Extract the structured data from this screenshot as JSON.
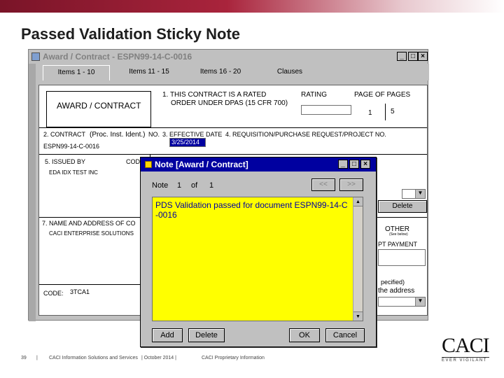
{
  "slide": {
    "title": "Passed Validation Sticky Note"
  },
  "window": {
    "title": "Award / Contract - ESPN99-14-C-0016",
    "buttons": {
      "minimize": "_",
      "restore": "□",
      "close": "×"
    }
  },
  "tabs": [
    {
      "label": "Items 1 - 10"
    },
    {
      "label": "Items 11 - 15"
    },
    {
      "label": "Items 16 - 20"
    },
    {
      "label": "Clauses"
    }
  ],
  "form": {
    "award_title": "AWARD / CONTRACT",
    "rated_label": "1. THIS CONTRACT IS A RATED",
    "dpas_label": "ORDER UNDER DPAS (15 CFR 700)",
    "rating_label": "RATING",
    "page_label": "PAGE OF PAGES",
    "page_current": "1",
    "page_total": "5",
    "contract_label": "2. CONTRACT",
    "proc_label": "(Proc. Inst. Ident.)",
    "no_label": "NO.",
    "contract_no": "ESPN99-14-C-0016",
    "effective_label": "3. EFFECTIVE DATE",
    "effective_date": "3/25/2014",
    "requisition_label": "4. REQUISITION/PURCHASE  REQUEST/PROJECT NO.",
    "issued_by_label": "5. ISSUED BY",
    "code_label": "COD",
    "issued_by_value": "EDA IDX TEST INC",
    "delete_label": "Delete",
    "name_label": "7. NAME AND ADDRESS OF CO",
    "name_value": "CACI ENTERPRISE SOLUTIONS",
    "other_label": "OTHER",
    "see_below_label": "(See below)",
    "prompt_payment_label": "PT PAYMENT",
    "specified_label": "pecified)",
    "address_label": "the address",
    "code_bottom_label": "CODE:",
    "code_bottom_value": "3TCA1"
  },
  "note": {
    "title": "Note [Award / Contract]",
    "note_label": "Note",
    "current": "1",
    "of_label": "of",
    "total": "1",
    "prev_label": "<<",
    "next_label": ">>",
    "text_line1": "PDS Validation passed for document ESPN99-14-C",
    "text_line2": "-0016",
    "buttons": {
      "add": "Add",
      "delete": "Delete",
      "ok": "OK",
      "cancel": "Cancel"
    },
    "text_color": "#0000a0",
    "background_color": "#ffff00"
  },
  "footer": {
    "page_number": "39",
    "sep1": "|",
    "company": "CACI Information Solutions and Services",
    "date": "| October 2014 |",
    "proprietary": "CACI Proprietary Information"
  },
  "logo": {
    "word": "CACI",
    "tagline": "EVER VIGILANT"
  },
  "colors": {
    "brand_red": "#a9243c",
    "window_gray": "#c0c0c0",
    "title_blue": "#0000a0"
  },
  "icons": [
    "window-system-icon",
    "note-icon",
    "dropdown-arrow-icon",
    "scroll-up-icon",
    "scroll-down-icon"
  ]
}
